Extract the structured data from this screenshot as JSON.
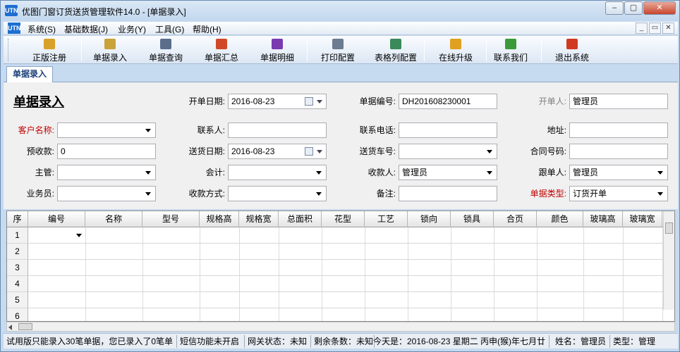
{
  "window": {
    "app_icon": "UTN",
    "title": "优图门窗订货送货管理软件14.0 - [单据录入]",
    "btn_minimize": "–",
    "btn_restore": "▢",
    "btn_close": "✕"
  },
  "menubar": {
    "items": [
      "系统(S)",
      "基础数据(J)",
      "业务(Y)",
      "工具(G)",
      "帮助(H)"
    ],
    "mdi_min": "_",
    "mdi_restore": "▭",
    "mdi_close": "✕"
  },
  "toolbar": {
    "buttons": [
      {
        "label": "正版注册",
        "icon": "lock-icon",
        "color": "#d8a12a"
      },
      {
        "label": "单据录入",
        "icon": "open-folder-icon",
        "color": "#c9a23a"
      },
      {
        "label": "单据查询",
        "icon": "query-form-icon",
        "color": "#5a6e8c"
      },
      {
        "label": "单据汇总",
        "icon": "bar-chart-icon",
        "color": "#d04a2a"
      },
      {
        "label": "单据明细",
        "icon": "column-chart-icon",
        "color": "#7a3ab0"
      },
      {
        "label": "打印配置",
        "icon": "print-settings-icon",
        "color": "#6b7b90"
      },
      {
        "label": "表格列配置",
        "icon": "table-config-icon",
        "color": "#3a8a5a"
      },
      {
        "label": "在线升级",
        "icon": "upgrade-icon",
        "color": "#e0a020"
      },
      {
        "label": "联系我们",
        "icon": "home-icon",
        "color": "#3a9a3a"
      },
      {
        "label": "退出系统",
        "icon": "exit-icon",
        "color": "#d03a20"
      }
    ]
  },
  "tab": {
    "label": "单据录入"
  },
  "form": {
    "title": "单据录入",
    "labels": {
      "open_date": "开单日期:",
      "doc_no": "单据编号:",
      "creator": "开单人:",
      "customer": "客户名称:",
      "contact": "联系人:",
      "phone": "联系电话:",
      "address": "地址:",
      "prepay": "预收款:",
      "delivery_date": "送货日期:",
      "vehicle": "送货车号:",
      "contract": "合同号码:",
      "supervisor": "主管:",
      "accountant": "会计:",
      "payee": "收款人:",
      "follower": "跟单人:",
      "salesman": "业务员:",
      "pay_method": "收款方式:",
      "remark": "备注:",
      "doc_type": "单据类型:"
    },
    "values": {
      "open_date": "2016-08-23",
      "doc_no": "DH201608230001",
      "creator": "管理员",
      "customer": "",
      "contact": "",
      "phone": "",
      "address": "",
      "prepay": "0",
      "delivery_date": "2016-08-23",
      "vehicle": "",
      "contract": "",
      "supervisor": "",
      "accountant": "",
      "payee": "管理员",
      "follower": "管理员",
      "salesman": "",
      "pay_method": "",
      "remark": "",
      "doc_type": "订货开单"
    }
  },
  "grid": {
    "columns": [
      "序",
      "编号",
      "名称",
      "型号",
      "规格高",
      "规格宽",
      "总面积",
      "花型",
      "工艺",
      "锁向",
      "锁具",
      "合页",
      "颜色",
      "玻璃高",
      "玻璃宽"
    ],
    "row_numbers": [
      "1",
      "2",
      "3",
      "4",
      "5",
      "6"
    ]
  },
  "statusbar": {
    "trial": "试用版只能录入30笔单据，您已录入了0笔单",
    "sms": "短信功能未开启",
    "gateway": "网关状态：未知",
    "remaining": "剩余条数：未知",
    "today": "今天是：2016-08-23 星期二 丙申(猴)年七月廿",
    "user_name": "姓名：管理员",
    "user_type": "类型：管理"
  }
}
